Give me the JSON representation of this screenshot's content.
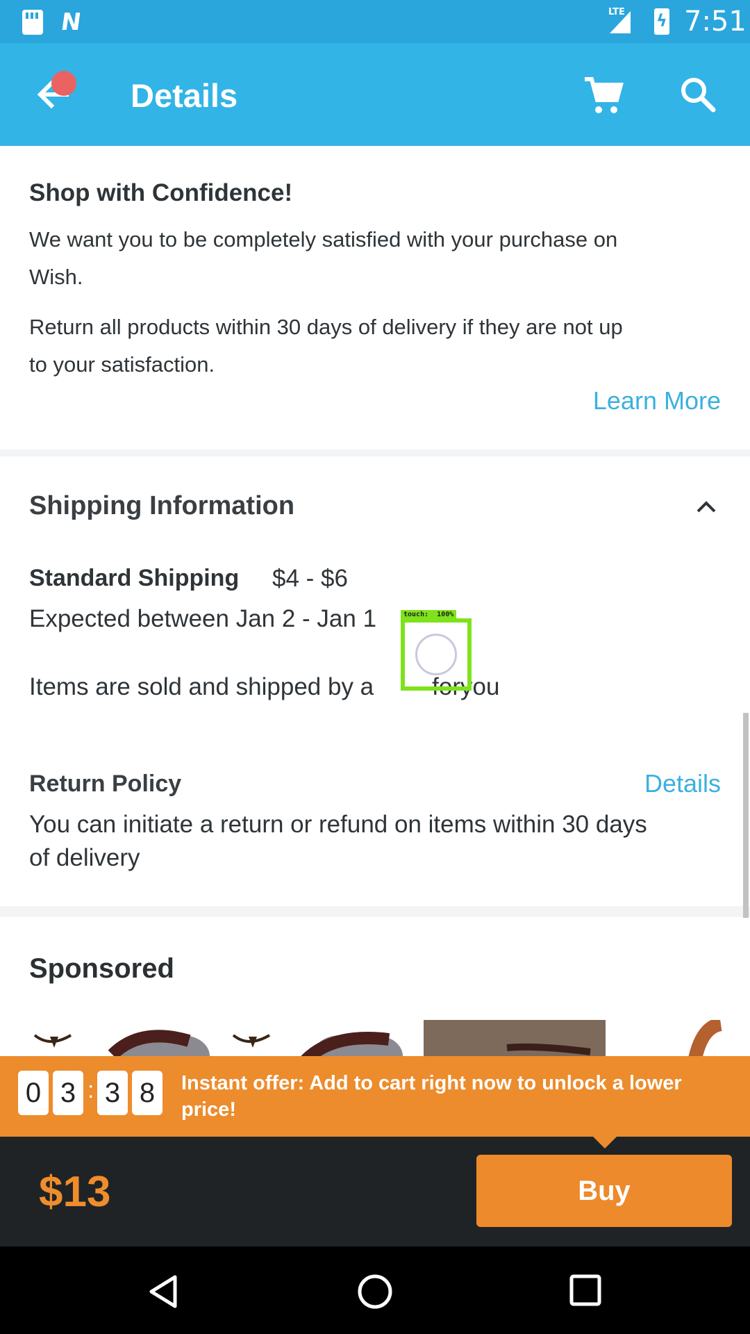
{
  "status_bar": {
    "time": "7:51",
    "network": "LTE",
    "notification_icon": "N"
  },
  "app_bar": {
    "title": "Details",
    "icons": [
      "back-arrow-icon",
      "cart-icon",
      "search-icon"
    ]
  },
  "confidence": {
    "heading": "Shop with Confidence!",
    "line1": "We want you to be completely satisfied with your purchase on",
    "line1b": "Wish.",
    "line2": "Return all products within 30 days of delivery if they are not up",
    "line2b": "to your satisfaction.",
    "learn_more": "Learn More"
  },
  "shipping": {
    "heading": "Shipping Information",
    "standard_label": "Standard Shipping",
    "standard_price": "$4 - $6",
    "expected": "Expected between Jan 2 - Jan 1",
    "sold_by_prefix": "Items are sold and shipped by a",
    "sold_by_suffix": "foryou",
    "return_heading": "Return Policy",
    "return_link": "Details",
    "return_text1": "You can initiate a return or refund on items within 30 days",
    "return_text2": "of delivery"
  },
  "touch_overlay": {
    "label": "touch:  100%"
  },
  "sponsored": {
    "heading": "Sponsored"
  },
  "offer": {
    "digits": [
      "0",
      "3",
      "3",
      "8"
    ],
    "colon": ":",
    "text": "Instant offer: Add to cart right now to unlock a lower price!"
  },
  "buy_bar": {
    "price": "$13",
    "button_label": "Buy"
  },
  "colors": {
    "status_bar": "#2aa6dd",
    "app_bar": "#33b4e6",
    "accent_link": "#3bb0e0",
    "offer_orange": "#ec8c2d",
    "buy_bar_bg": "#1f2326"
  }
}
